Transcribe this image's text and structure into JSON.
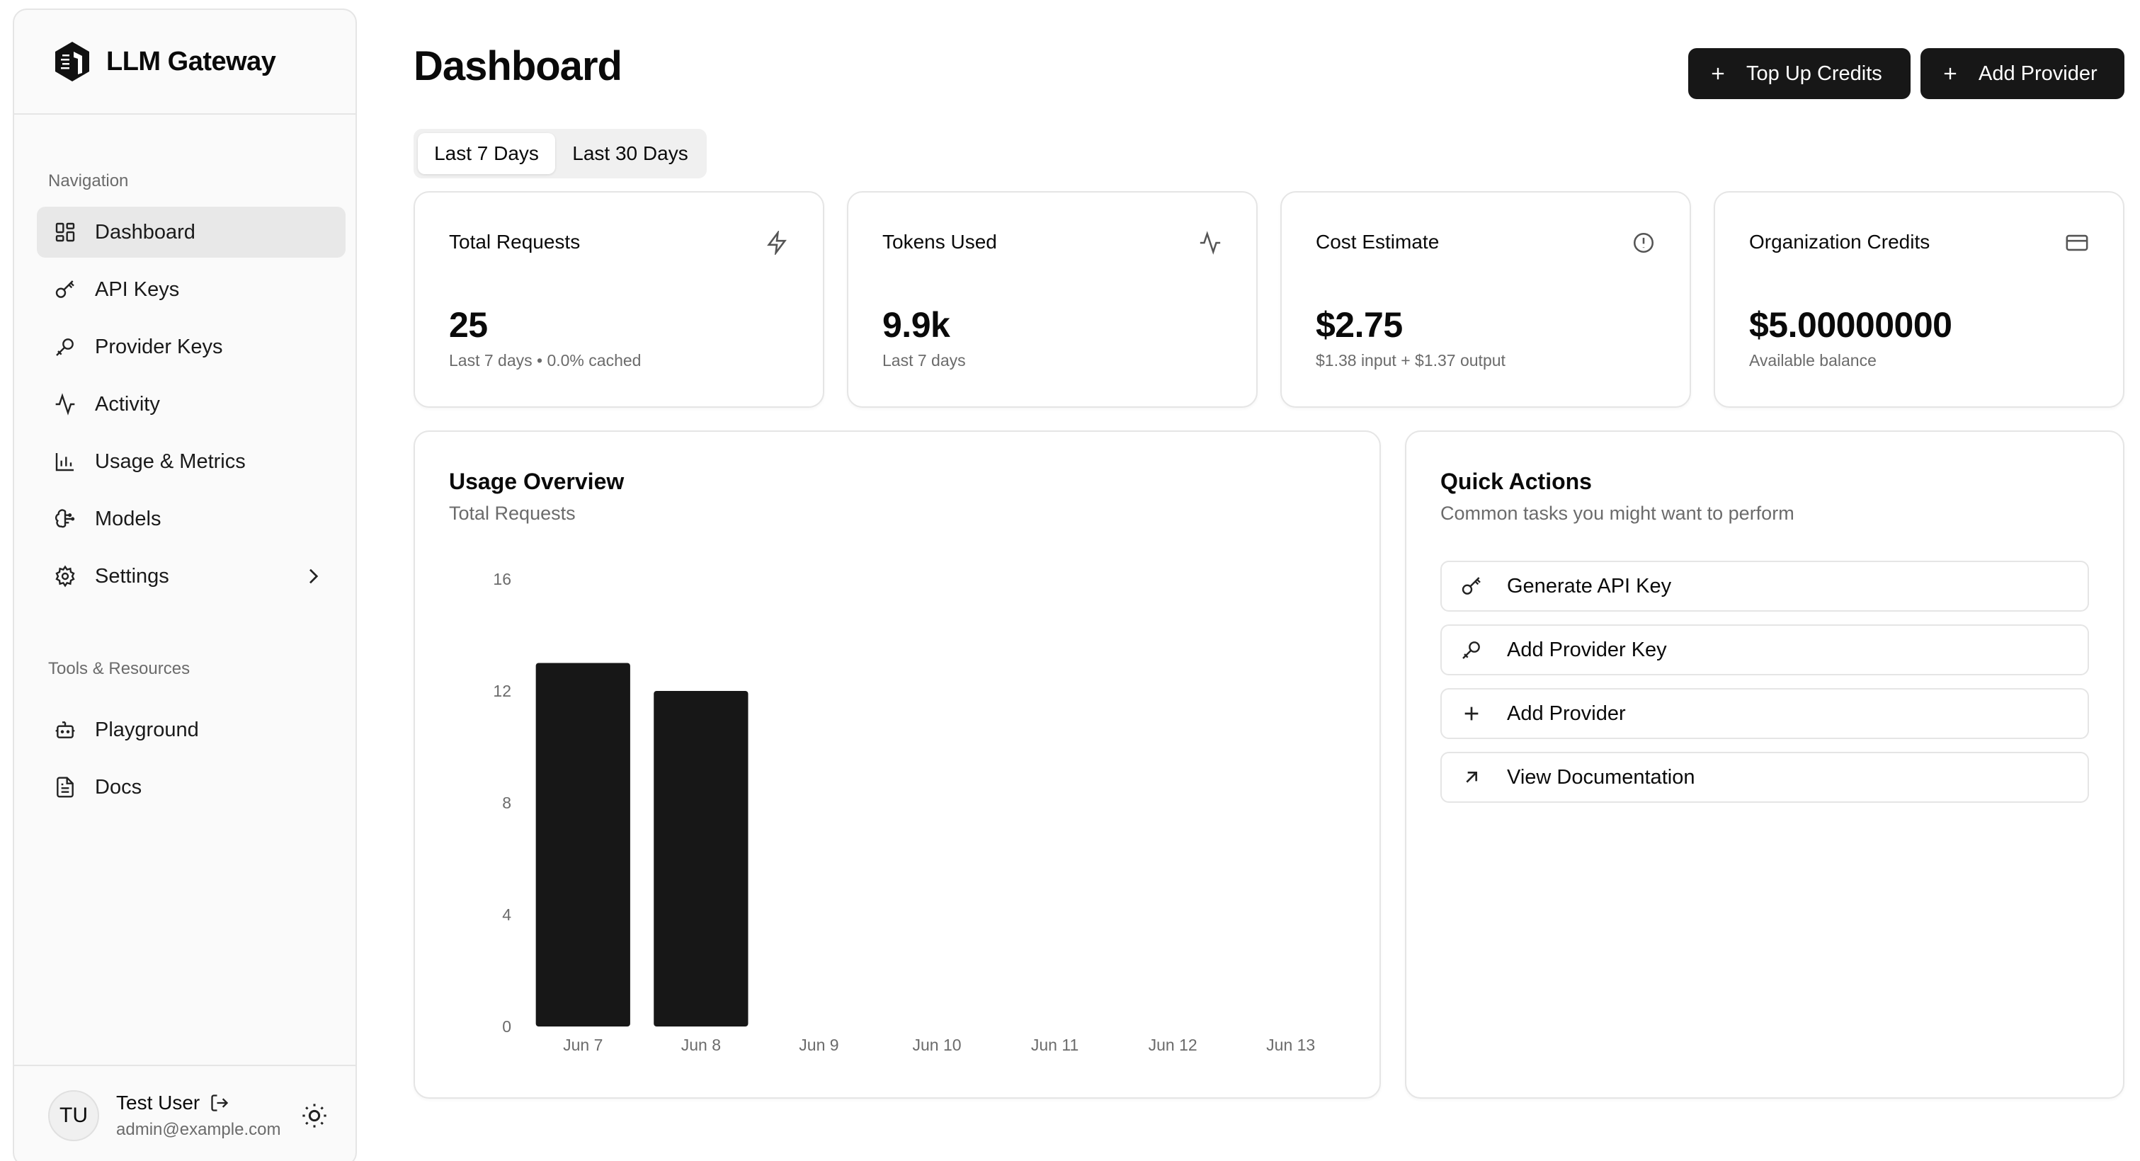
{
  "app": {
    "brand": "LLM Gateway"
  },
  "sidebar": {
    "navigation_label": "Navigation",
    "items": [
      {
        "label": "Dashboard",
        "icon": "grid-icon",
        "active": true
      },
      {
        "label": "API Keys",
        "icon": "key-icon"
      },
      {
        "label": "Provider Keys",
        "icon": "provider-key-icon"
      },
      {
        "label": "Activity",
        "icon": "activity-icon"
      },
      {
        "label": "Usage & Metrics",
        "icon": "bar-chart-icon"
      },
      {
        "label": "Models",
        "icon": "brain-icon"
      },
      {
        "label": "Settings",
        "icon": "gear-icon"
      }
    ],
    "tools_label": "Tools & Resources",
    "tools": [
      {
        "label": "Playground",
        "icon": "bot-icon"
      },
      {
        "label": "Docs",
        "icon": "document-icon"
      }
    ],
    "user": {
      "initials": "TU",
      "name": "Test User",
      "email": "admin@example.com"
    }
  },
  "header": {
    "title": "Dashboard",
    "top_up_label": "Top Up Credits",
    "add_provider_label": "Add Provider"
  },
  "range": {
    "tabs": [
      "Last 7 Days",
      "Last 30 Days"
    ],
    "selected": "Last 7 Days"
  },
  "stats": [
    {
      "title": "Total Requests",
      "value": "25",
      "sub": "Last 7 days • 0.0% cached",
      "icon": "lightning-icon"
    },
    {
      "title": "Tokens Used",
      "value": "9.9k",
      "sub": "Last 7 days",
      "icon": "activity-icon"
    },
    {
      "title": "Cost Estimate",
      "value": "$2.75",
      "sub": "$1.38 input + $1.37 output",
      "icon": "info-circle-icon"
    },
    {
      "title": "Organization Credits",
      "value": "$5.00000000",
      "sub": "Available balance",
      "icon": "credit-card-icon"
    }
  ],
  "usage": {
    "title": "Usage Overview",
    "subtitle": "Total Requests"
  },
  "chart_data": {
    "type": "bar",
    "categories": [
      "Jun 7",
      "Jun 8",
      "Jun 9",
      "Jun 10",
      "Jun 11",
      "Jun 12",
      "Jun 13"
    ],
    "values": [
      13,
      12,
      0,
      0,
      0,
      0,
      0
    ],
    "ylim": [
      0,
      16
    ],
    "yticks": [
      0,
      4,
      8,
      12,
      16
    ],
    "bar_color": "#171717",
    "grid": false,
    "title": "",
    "xlabel": "",
    "ylabel": ""
  },
  "quick_actions": {
    "title": "Quick Actions",
    "subtitle": "Common tasks you might want to perform",
    "items": [
      {
        "label": "Generate API Key",
        "icon": "key-icon"
      },
      {
        "label": "Add Provider Key",
        "icon": "provider-key-icon"
      },
      {
        "label": "Add Provider",
        "icon": "plus-icon"
      },
      {
        "label": "View Documentation",
        "icon": "arrow-up-right-icon"
      }
    ]
  }
}
